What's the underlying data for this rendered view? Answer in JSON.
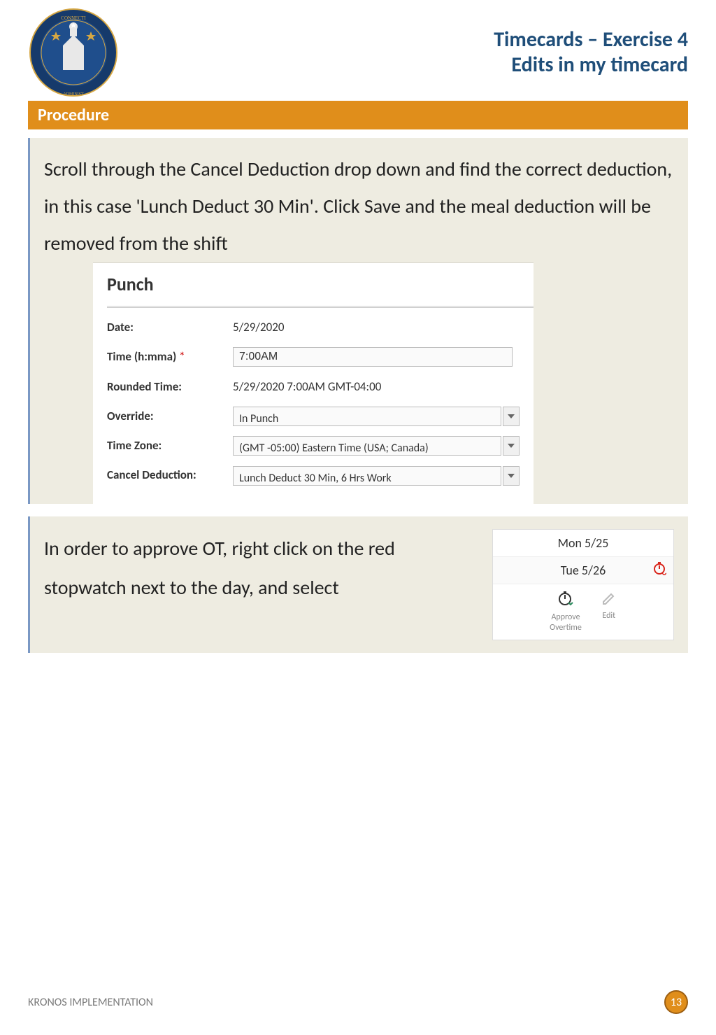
{
  "header": {
    "title_line1": "Timecards – Exercise 4",
    "title_line2": "Edits in my timecard"
  },
  "procedure_label": "Procedure",
  "section1": {
    "paragraph": "Scroll through the Cancel Deduction drop down and find the correct deduction, in this case 'Lunch Deduct 30 Min'. Click Save and the meal deduction will be removed from the shift",
    "punch_title": "Punch",
    "fields": {
      "date_label": "Date:",
      "date_value": "5/29/2020",
      "time_label": "Time (h:mma)",
      "time_req": "*",
      "time_value": "7:00AM",
      "rounded_label": "Rounded Time:",
      "rounded_value": "5/29/2020 7:00AM GMT-04:00",
      "override_label": "Override:",
      "override_value": "In Punch",
      "tz_label": "Time Zone:",
      "tz_value": "(GMT -05:00) Eastern Time (USA; Canada)",
      "cancel_label": "Cancel Deduction:",
      "cancel_value": "Lunch Deduct 30 Min, 6 Hrs Work"
    }
  },
  "section2": {
    "paragraph": "In order to approve OT, right click on the red stopwatch next to the day, and select",
    "rows": {
      "mon": "Mon 5/25",
      "tue": "Tue 5/26"
    },
    "actions": {
      "approve_line1": "Approve",
      "approve_line2": "Overtime",
      "edit": "Edit"
    }
  },
  "footer": {
    "text": "KRONOS IMPLEMENTATION",
    "page": "13"
  }
}
